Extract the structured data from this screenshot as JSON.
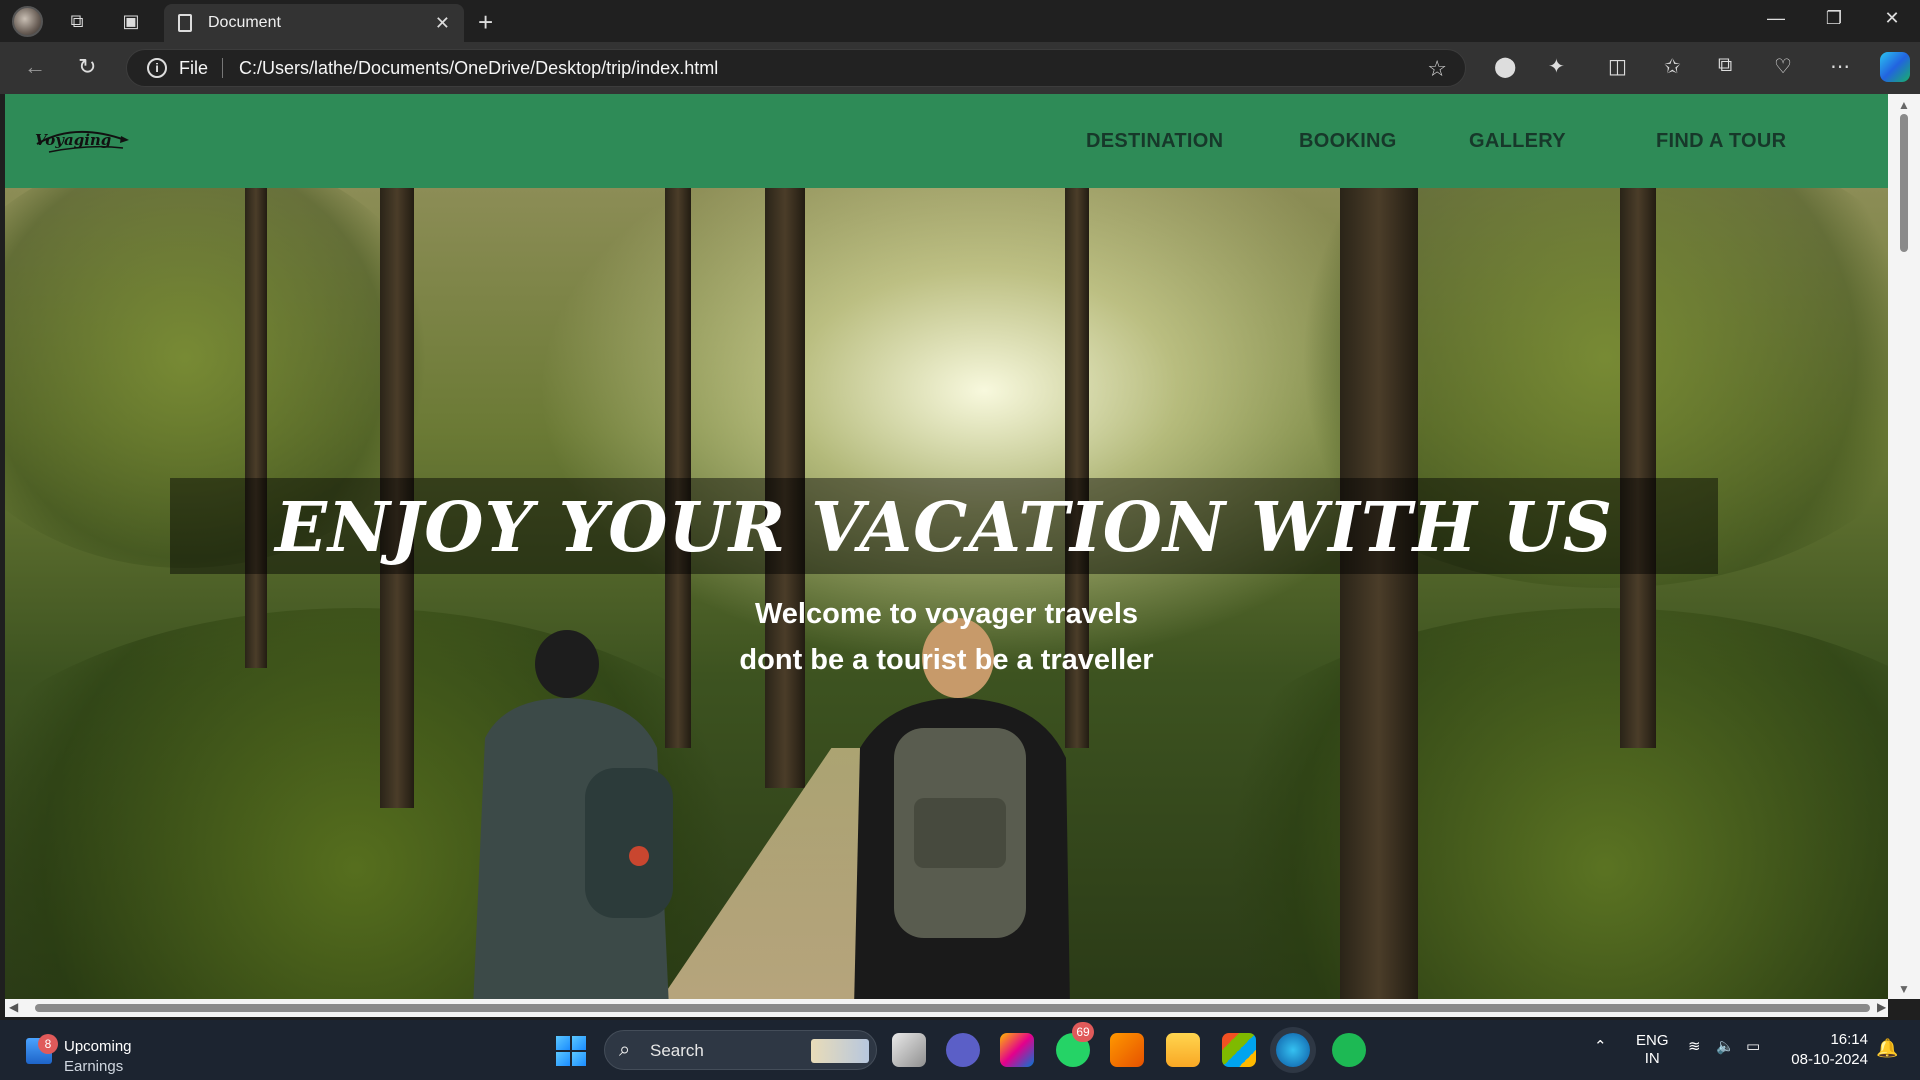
{
  "browser": {
    "tab_title": "Document",
    "address_prefix": "File",
    "address": "C:/Users/lathe/Documents/OneDrive/Desktop/trip/index.html"
  },
  "site": {
    "logo_text": "Voyaging",
    "nav": [
      "DESTINATION",
      "BOOKING",
      "GALLERY",
      "FIND A TOUR"
    ],
    "hero_title": "ENJOY YOUR VACATION WITH US",
    "hero_sub1": "Welcome to voyager travels",
    "hero_sub2": "dont be a tourist be a traveller",
    "brand_color": "#2e8b57"
  },
  "taskbar": {
    "weather_badge": "8",
    "weather_line1": "Upcoming",
    "weather_line2": "Earnings",
    "search_label": "Search",
    "whatsapp_badge": "69",
    "lang1": "ENG",
    "lang2": "IN",
    "time": "16:14",
    "date": "08-10-2024"
  },
  "icons": [
    "profile-avatar",
    "workspaces-icon",
    "tab-actions-icon",
    "document-icon",
    "close-icon",
    "plus-icon",
    "minimize-icon",
    "restore-icon",
    "close-window-icon",
    "back-icon",
    "refresh-icon",
    "info-icon",
    "star-icon",
    "extensions-icon",
    "split-screen-icon",
    "favorites-icon",
    "collections-icon",
    "health-icon",
    "more-icon",
    "copilot-icon",
    "search-icon",
    "bell-icon"
  ]
}
